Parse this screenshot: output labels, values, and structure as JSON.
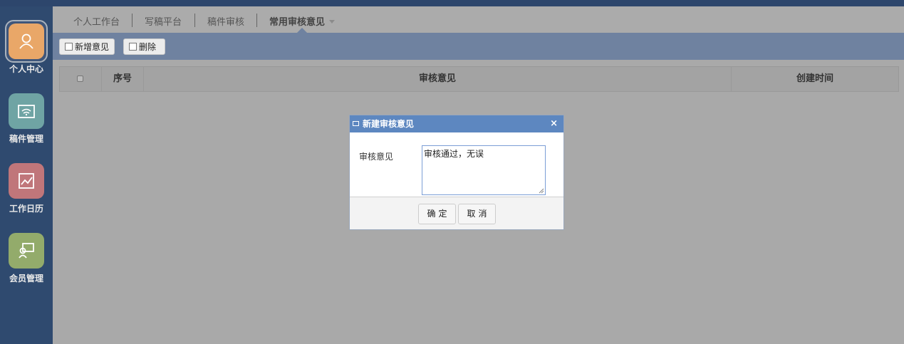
{
  "sidebar": {
    "items": [
      {
        "label": "个人中心",
        "icon": "person-icon",
        "color": "#e9a768",
        "active": true
      },
      {
        "label": "稿件管理",
        "icon": "manuscript-icon",
        "color": "#6fa4a4",
        "active": false
      },
      {
        "label": "工作日历",
        "icon": "calendar-chart-icon",
        "color": "#c0767a",
        "active": false
      },
      {
        "label": "会员管理",
        "icon": "member-icon",
        "color": "#93ab6b",
        "active": false
      }
    ]
  },
  "tabs": [
    {
      "label": "个人工作台"
    },
    {
      "label": "写稿平台"
    },
    {
      "label": "稿件审核"
    },
    {
      "label": "常用审核意见",
      "active": true
    }
  ],
  "toolbar": {
    "add_label": "新增意见",
    "delete_label": "删除"
  },
  "table": {
    "columns": [
      "",
      "序号",
      "审核意见",
      "创建时间"
    ],
    "rows": []
  },
  "dialog": {
    "title": "新建审核意见",
    "close": "×",
    "field_label": "审核意见",
    "field_value": "审核通过，无误",
    "confirm_label": "确定",
    "cancel_label": "取消"
  },
  "colors": {
    "sidebar_bg": "#2f4a6f",
    "toolbar_bg": "#6f82a0",
    "dialog_title_bg": "#5d87c0"
  }
}
